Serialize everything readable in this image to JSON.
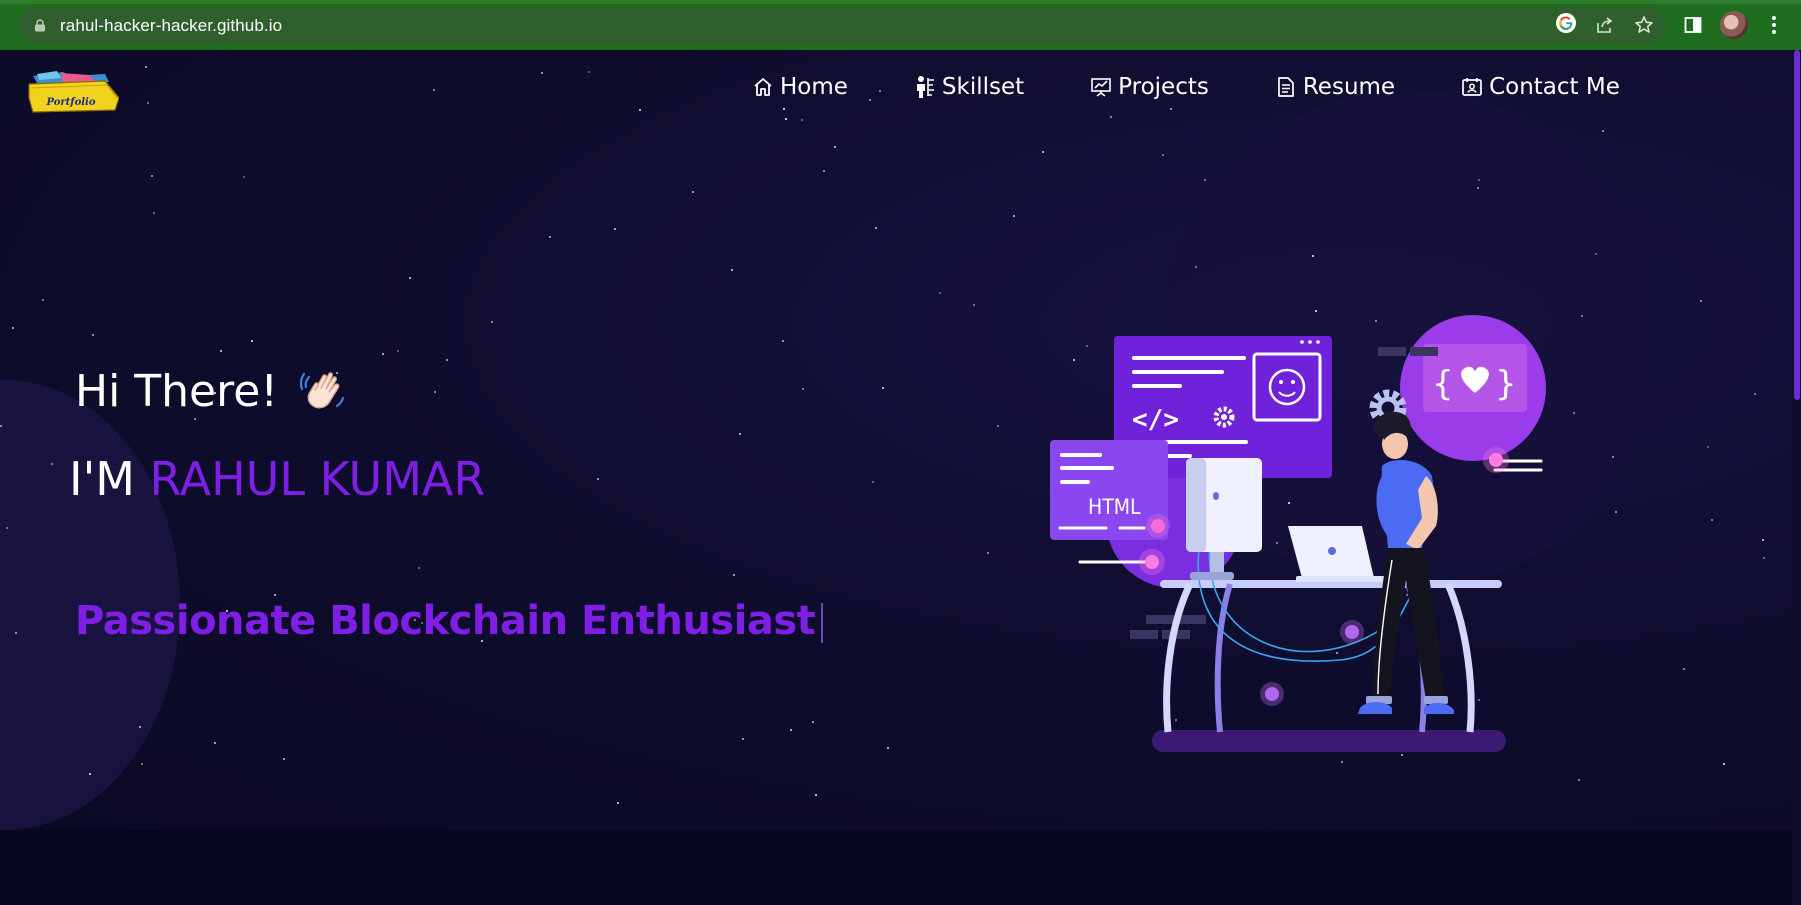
{
  "browser": {
    "url": "rahul-hacker-hacker.github.io"
  },
  "logo": {
    "text": "Portfolio"
  },
  "nav": {
    "items": [
      {
        "label": "Home",
        "icon": "home-icon"
      },
      {
        "label": "Skillset",
        "icon": "skillset-icon"
      },
      {
        "label": "Projects",
        "icon": "projects-icon"
      },
      {
        "label": "Resume",
        "icon": "resume-icon"
      },
      {
        "label": "Contact Me",
        "icon": "contact-icon"
      }
    ]
  },
  "hero": {
    "greeting": "Hi There!",
    "intro_prefix": "I'M ",
    "name": "RAHUL KUMAR",
    "tagline": "Passionate Blockchain Enthusiast"
  },
  "illustration": {
    "html_label": "HTML"
  },
  "colors": {
    "accent": "#7f1fe6",
    "background": "#0d0b29",
    "chrome": "#1f6e1f"
  }
}
